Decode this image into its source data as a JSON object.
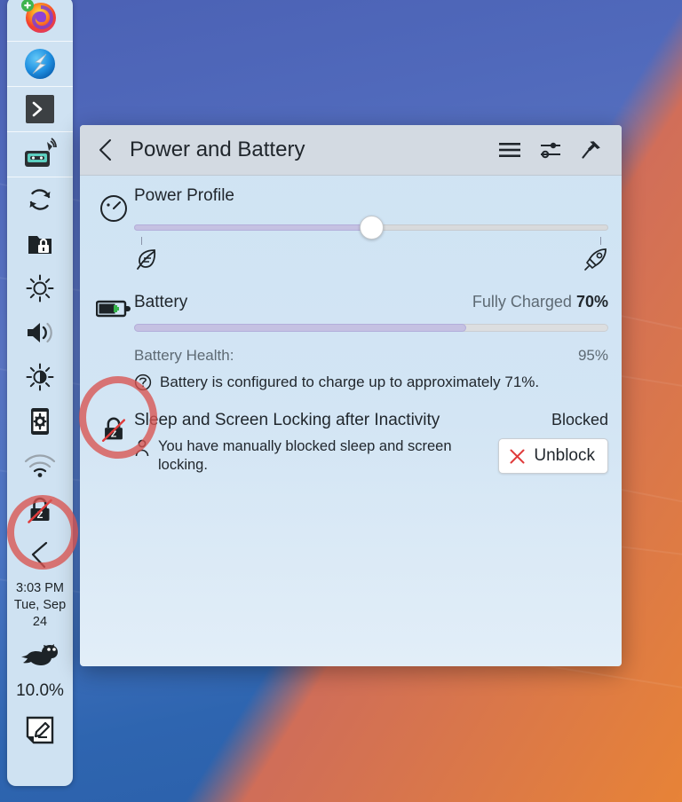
{
  "window": {
    "title": "Power and Battery",
    "header_icons": [
      {
        "name": "hamburger-menu-icon",
        "label": "Menu"
      },
      {
        "name": "configure-sliders-icon",
        "label": "Configure"
      },
      {
        "name": "pin-icon",
        "label": "Keep Open"
      }
    ],
    "back_label": "Back"
  },
  "power_profile": {
    "title": "Power Profile",
    "icon": "speedometer-icon",
    "value_percent": 50,
    "left_icon": "leaf-icon",
    "right_icon": "rocket-icon"
  },
  "battery": {
    "title": "Battery",
    "icon": "battery-charging-icon",
    "status": "Fully Charged",
    "percent": "70%",
    "percent_value": 70,
    "health_label": "Battery Health:",
    "health_value": "95%",
    "note_icon": "info-icon",
    "note": "Battery is configured to charge up to approximately 71%."
  },
  "sleep": {
    "title": "Sleep and Screen Locking after Inactivity",
    "icon": "sleep-blocked-icon",
    "status": "Blocked",
    "reason_icon": "user-icon",
    "reason": "You have manually blocked sleep and screen locking.",
    "button_label": "Unblock",
    "button_icon": "close-x-icon"
  },
  "tray": {
    "items": [
      {
        "name": "firefox-icon",
        "label": "Firefox"
      },
      {
        "name": "falkon-browser-icon",
        "label": "Falkon"
      },
      {
        "name": "terminal-icon",
        "label": "Terminal"
      },
      {
        "name": "audio-recorder-icon",
        "label": "Audio Recorder"
      },
      {
        "name": "sync-refresh-icon",
        "label": "Sync"
      },
      {
        "name": "folder-lock-icon",
        "label": "Vault"
      },
      {
        "name": "brightness-icon",
        "label": "Brightness"
      },
      {
        "name": "volume-icon",
        "label": "Volume"
      },
      {
        "name": "display-brightness-icon",
        "label": "Display Brightness"
      },
      {
        "name": "device-settings-icon",
        "label": "Device Settings"
      },
      {
        "name": "wifi-icon",
        "label": "Networks"
      },
      {
        "name": "sleep-blocked-icon",
        "label": "Sleep Blocked"
      },
      {
        "name": "collapse-arrow-icon",
        "label": "Hide"
      }
    ],
    "clock_time": "3:03 PM",
    "clock_date_line1": "Tue, Sep",
    "clock_date_line2": "24",
    "cpu_icon": "cat-icon",
    "cpu_percent": "10.0%",
    "notes_icon": "notes-edit-icon"
  },
  "colors": {
    "accent_purple": "#c5c1e2",
    "annotation_red": "#d9534f",
    "popup_body": "#d3e5f4",
    "header_bar": "#d3dae2",
    "tray_bg": "#cfe2f2"
  }
}
